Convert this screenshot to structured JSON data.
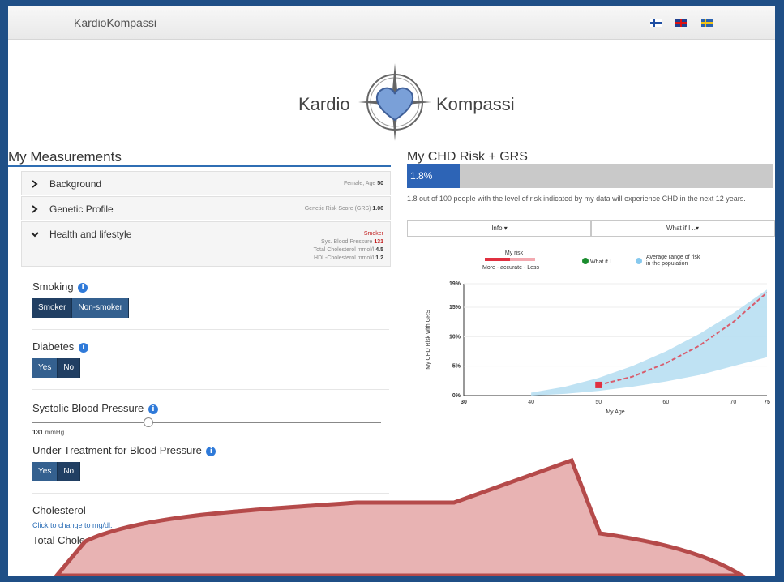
{
  "navbar": {
    "brand": "KardioKompassi"
  },
  "logo": {
    "left": "Kardio",
    "right": "Kompassi"
  },
  "left": {
    "title": "My Measurements",
    "accordion": [
      {
        "label": "Background",
        "summary": "Female, Age",
        "summary_value": "50"
      },
      {
        "label": "Genetic Profile",
        "summary": "Genetic Risk Score (GRS)",
        "summary_value": "1.06"
      },
      {
        "label": "Health and lifestyle",
        "lines": [
          {
            "text": "Smoker",
            "value": ""
          },
          {
            "text": "Sys. Blood Pressure",
            "value": "131"
          },
          {
            "text": "Total Cholesterol mmol/l",
            "value": "4.5"
          },
          {
            "text": "HDL-Cholesterol mmol/l",
            "value": "1.2"
          }
        ]
      }
    ],
    "smoking": {
      "label": "Smoking",
      "options": [
        "Smoker",
        "Non-smoker"
      ],
      "selected": "Smoker"
    },
    "diabetes": {
      "label": "Diabetes",
      "options": [
        "Yes",
        "No"
      ],
      "selected": "No"
    },
    "sbp": {
      "label": "Systolic Blood Pressure",
      "value": "131",
      "unit": "mmHg",
      "level": 0.33
    },
    "treatment": {
      "label": "Under Treatment for Blood Pressure",
      "options": [
        "Yes",
        "No"
      ],
      "selected": "No"
    },
    "cholesterol": {
      "label": "Cholesterol",
      "link": "Click to change to mg/dl."
    },
    "total_chol": {
      "label": "Total Cholesterol"
    }
  },
  "right": {
    "title": "My CHD Risk + GRS",
    "risk_value": "1.8%",
    "risk_fraction": 0.018,
    "description": "1.8 out of 100 people with the level of risk indicated by my data will experience CHD in the next 12 years.",
    "tabs": [
      "Info ▾",
      "What if I ..▾"
    ]
  },
  "chart_data": {
    "type": "line",
    "xlabel": "My Age",
    "ylabel": "My CHD Risk with GRS",
    "xlim": [
      30,
      75
    ],
    "ylim": [
      0,
      19
    ],
    "x_ticks": [
      "30",
      "40",
      "50",
      "60",
      "70",
      "75"
    ],
    "y_ticks": [
      "0%",
      "5%",
      "10%",
      "15%",
      "19%"
    ],
    "legend": {
      "my_risk": "My risk",
      "accuracy": "More - accurate - Less",
      "what_if": "What if I ..",
      "population": "Average range of risk",
      "population2": "in the population"
    },
    "legend_position": "top",
    "band_x": [
      40,
      45,
      50,
      55,
      60,
      65,
      70,
      75
    ],
    "band_low": [
      0,
      0.3,
      0.8,
      1.5,
      2.4,
      3.5,
      5.0,
      6.5
    ],
    "band_high": [
      0.5,
      1.5,
      3.0,
      5.0,
      7.5,
      10.5,
      14.0,
      18.0
    ],
    "my_risk_x": [
      50,
      55,
      60,
      65,
      70,
      75
    ],
    "my_risk_y": [
      1.8,
      3.2,
      5.5,
      8.5,
      12.5,
      17.5
    ],
    "current_point": {
      "x": 50,
      "y": 1.8
    },
    "colors": {
      "band": "#b8dff2",
      "risk": "#e03040",
      "what_if": "#1a8c2e",
      "population": "#87c9ee"
    }
  },
  "colors": {
    "frame": "#1f4f86",
    "accent": "#2f6eb3",
    "button": "#2a4e77",
    "callout": "#e8b3b3",
    "callout_border": "#b54a4a"
  }
}
